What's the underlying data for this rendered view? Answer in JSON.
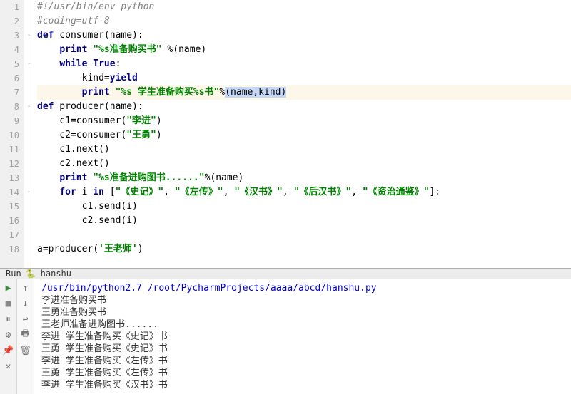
{
  "editor": {
    "lines": [
      {
        "n": 1,
        "fold": "",
        "html": "<span class='cmt'>#!/usr/bin/env python</span>"
      },
      {
        "n": 2,
        "fold": "",
        "html": "<span class='cmt'>#coding=utf-8</span>"
      },
      {
        "n": 3,
        "fold": "-",
        "html": "<span class='kw'>def</span> consumer(name):"
      },
      {
        "n": 4,
        "fold": "",
        "html": "    <span class='kw'>print</span> <span class='str'>\"%s准备购买书\"</span> %(name)"
      },
      {
        "n": 5,
        "fold": "-",
        "html": "    <span class='kw'>while</span> <span class='kw'>True</span>:"
      },
      {
        "n": 6,
        "fold": "",
        "html": "        kind=<span class='kw'>yield</span>"
      },
      {
        "n": 7,
        "fold": "",
        "hl": true,
        "html": "        <span class='kw'>print</span> <span class='str'>\"%s 学生准备购买%s书\"</span>%<span class='caret-r'>(name,kind)</span>"
      },
      {
        "n": 8,
        "fold": "-",
        "html": "<span class='kw'>def</span> producer(name):"
      },
      {
        "n": 9,
        "fold": "",
        "html": "    c1=consumer(<span class='str'>\"李进\"</span>)"
      },
      {
        "n": 10,
        "fold": "",
        "html": "    c2=consumer(<span class='str'>\"王勇\"</span>)"
      },
      {
        "n": 11,
        "fold": "",
        "html": "    c1.next()"
      },
      {
        "n": 12,
        "fold": "",
        "html": "    c2.next()"
      },
      {
        "n": 13,
        "fold": "",
        "html": "    <span class='kw'>print</span> <span class='str'>\"%s准备进购图书......\"</span>%(name)"
      },
      {
        "n": 14,
        "fold": "-",
        "html": "    <span class='kw'>for</span> i <span class='kw'>in</span> [<span class='str'>\"《史记》\"</span>, <span class='str'>\"《左传》\"</span>, <span class='str'>\"《汉书》\"</span>, <span class='str'>\"《后汉书》\"</span>, <span class='str'>\"《资治通鉴》\"</span>]:"
      },
      {
        "n": 15,
        "fold": "",
        "html": "        c1.send(i)"
      },
      {
        "n": 16,
        "fold": "",
        "html": "        c2.send(i)"
      },
      {
        "n": 17,
        "fold": "",
        "html": ""
      },
      {
        "n": 18,
        "fold": "",
        "html": "a=producer(<span class='str'>'王老师'</span>)"
      }
    ]
  },
  "run": {
    "tab_label": "Run",
    "config_name": "hanshu",
    "command": "/usr/bin/python2.7 /root/PycharmProjects/aaaa/abcd/hanshu.py",
    "output": [
      "李进准备购买书",
      "王勇准备购买书",
      "王老师准备进购图书......",
      "李进 学生准备购买《史记》书",
      "王勇 学生准备购买《史记》书",
      "李进 学生准备购买《左传》书",
      "王勇 学生准备购买《左传》书",
      "李进 学生准备购买《汉书》书"
    ]
  },
  "icons": {
    "play": "▶",
    "stop": "■",
    "pause": "⏸",
    "up": "↑",
    "down": "↓",
    "settings": "⚙",
    "print": "🖶",
    "trash": "🗑",
    "pin": "📌",
    "wrap": "↩"
  }
}
